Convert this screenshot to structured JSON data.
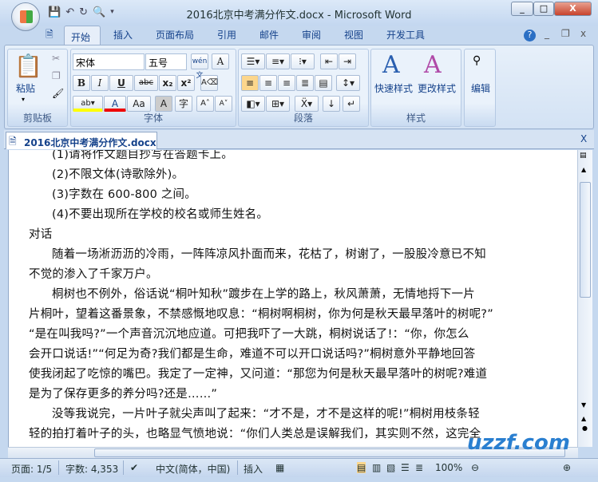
{
  "window": {
    "title": "2016北京中考满分作文.docx - Microsoft Word",
    "min": "_",
    "restore": "□",
    "close": "X"
  },
  "ribbon_tabs": [
    "开始",
    "插入",
    "页面布局",
    "引用",
    "邮件",
    "审阅",
    "视图",
    "开发工具"
  ],
  "ribbon": {
    "clipboard": {
      "label": "剪贴板",
      "paste": "粘贴"
    },
    "font": {
      "label": "字体",
      "font_name": "宋体",
      "font_size": "五号",
      "bold": "B",
      "italic": "I",
      "underline": "U",
      "strike": "abc",
      "sub": "x₂",
      "sup": "x²",
      "font_color": "A",
      "case": "Aa",
      "grow": "A˄",
      "shrink": "A˅",
      "phonetic": "wén文",
      "border_char": "A",
      "enclose": "字"
    },
    "paragraph": {
      "label": "段落"
    },
    "styles": {
      "label": "样式",
      "quick": "快速样式",
      "change": "更改样式"
    },
    "editing": {
      "label": "编辑"
    }
  },
  "doc_tab": "2016北京中考满分作文.docx",
  "doc_lines": [
    {
      "text": "(1)请将作文题目抄写在答题卡上。",
      "indent": true
    },
    {
      "text": "(2)不限文体(诗歌除外)。",
      "indent": true
    },
    {
      "text": "(3)字数在 600-800 之间。",
      "indent": true
    },
    {
      "text": "(4)不要出现所在学校的校名或师生姓名。",
      "indent": true
    },
    {
      "text": "对话",
      "indent": false
    },
    {
      "text": "随着一场淅沥沥的冷雨，一阵阵凉风扑面而来，花枯了，树谢了，一股股冷意已不知",
      "indent": true
    },
    {
      "text": "不觉的渗入了千家万户。",
      "indent": false
    },
    {
      "text": "桐树也不例外，俗话说“桐叶知秋”踱步在上学的路上，秋风萧萧，无情地捋下一片",
      "indent": true
    },
    {
      "text": "片桐叶，望着这番景象，不禁感慨地叹息：“桐树啊桐树，你为何是秋天最早落叶的树呢?”",
      "indent": false
    },
    {
      "text": "“是在叫我吗?”一个声音沉沉地应道。可把我吓了一大跳，桐树说话了!：“你，你怎么",
      "indent": false
    },
    {
      "text": "会开口说话!”“何足为奇?我们都是生命，难道不可以开口说话吗?”桐树意外平静地回答",
      "indent": false
    },
    {
      "text": "使我闭起了吃惊的嘴巴。我定了一定神，又问道：“那您为何是秋天最早落叶的树呢?难道",
      "indent": false
    },
    {
      "text": "是为了保存更多的养分吗?还是……”",
      "indent": false
    },
    {
      "text": "没等我说完，一片叶子就尖声叫了起来：“才不是，才不是这样的呢!”桐树用枝条轻",
      "indent": true
    },
    {
      "text": "轻的拍打着叶子的头，也略显气愤地说：“你们人类总是误解我们，其实则不然，这完全",
      "indent": false
    }
  ],
  "status": {
    "page": "页面: 1/5",
    "words": "字数: 4,353",
    "language": "中文(简体，中国)",
    "mode": "插入",
    "zoom": "100%"
  },
  "watermark": "uzzf.com"
}
